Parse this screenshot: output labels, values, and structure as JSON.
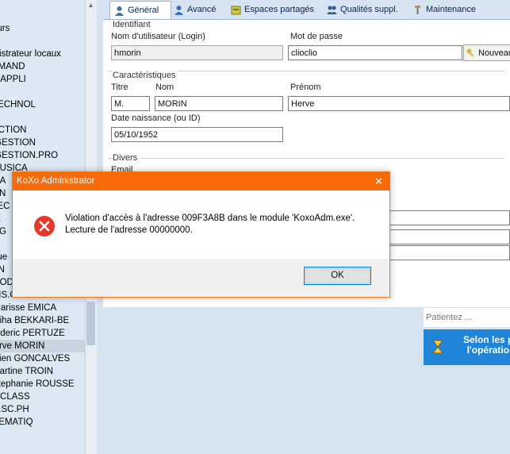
{
  "sidebar": {
    "items": [
      "eurs",
      "3",
      "inistrateur locaux",
      "EMAND",
      "S APPLI",
      "",
      "TECHNOL",
      "",
      "ECTION",
      ".GESTION",
      ".GESTION.PRO",
      "MUSICA",
      "MA",
      "ON",
      "LEC",
      "IE",
      "T.G",
      "",
      "que",
      "AN",
      "MODERN",
      "HIS.GE",
      "Clarisse EMICA",
      "atiha BEKKARI-BE",
      "rederic PERTUZE",
      "lerve MORIN",
      "ulien GONCALVES",
      "Martine TROIN",
      "Stephanie ROUSSE",
      "T CLASS",
      "H.SC.PH",
      "HEMATIQ"
    ],
    "selected_index": 25
  },
  "tabs": [
    "Général",
    "Avancé",
    "Espaces partagés",
    "Qualités suppl.",
    "Maintenance"
  ],
  "identifiant": {
    "title": "Identifiant",
    "login_label": "Nom d'utilisateur (Login)",
    "login_value": "hmorin",
    "password_label": "Mot de passe",
    "password_value": "clioclio",
    "new_button": "Nouveau"
  },
  "caracteristiques": {
    "title": "Caractéristiques",
    "titre_label": "Titre",
    "titre_value": "M.",
    "nom_label": "Nom",
    "nom_value": "MORIN",
    "prenom_label": "Prénom",
    "prenom_value": "Herve",
    "date_label": "Date naissance (ou ID)",
    "date_value": "05/10/1952"
  },
  "divers": {
    "title": "Divers",
    "email_label": "Email"
  },
  "dialog": {
    "title": "KoXo Administrator",
    "close": "✕",
    "message_line1": "Violation d'accès à l'adresse 009F3A8B dans le module 'KoxoAdm.exe'.",
    "message_line2": "Lecture de l'adresse 00000000.",
    "ok_label": "OK"
  },
  "wait": {
    "patientez": "Patientez ...",
    "line1": "Selon les pé",
    "line2": "l'opération"
  },
  "colors": {
    "dialog_title": "#f76a07",
    "error_red": "#e23b2e",
    "wait_blue": "#1f85d8"
  }
}
